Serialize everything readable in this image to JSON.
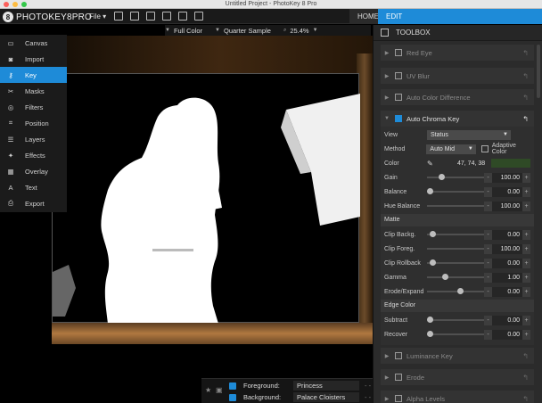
{
  "window": {
    "title": "Untitled Project - PhotoKey 8 Pro"
  },
  "app": {
    "logo_text": "PHOTOKEY8PRO",
    "file_menu": "File",
    "tabs": {
      "home": "HOME",
      "edit": "EDIT"
    }
  },
  "viewbar": {
    "display": "Full Color",
    "quality": "Quarter Sample",
    "zoom": "25.4%"
  },
  "tools": [
    {
      "label": "Canvas",
      "icon": "canvas-icon",
      "active": false
    },
    {
      "label": "Import",
      "icon": "camera-icon",
      "active": false
    },
    {
      "label": "Key",
      "icon": "key-icon",
      "active": true
    },
    {
      "label": "Masks",
      "icon": "scissors-icon",
      "active": false
    },
    {
      "label": "Filters",
      "icon": "filters-icon",
      "active": false
    },
    {
      "label": "Position",
      "icon": "crop-icon",
      "active": false
    },
    {
      "label": "Layers",
      "icon": "layers-icon",
      "active": false
    },
    {
      "label": "Effects",
      "icon": "wand-icon",
      "active": false
    },
    {
      "label": "Overlay",
      "icon": "grid-icon",
      "active": false
    },
    {
      "label": "Text",
      "icon": "text-icon",
      "active": false
    },
    {
      "label": "Export",
      "icon": "export-icon",
      "active": false
    }
  ],
  "layers": {
    "foreground_label": "Foreground:",
    "foreground_value": "Princess",
    "background_label": "Background:",
    "background_value": "Palace Cloisters"
  },
  "toolbox": {
    "title": "TOOLBOX",
    "sections_top": [
      "Red Eye",
      "UV Blur",
      "Auto Color Difference"
    ],
    "chroma": {
      "title": "Auto Chroma Key",
      "view_label": "View",
      "view_value": "Status",
      "method_label": "Method",
      "method_value": "Auto Mid",
      "adaptive_label": "Adaptive Color",
      "color_label": "Color",
      "color_rgb": "47, 74, 38",
      "color_hex": "#2f4a26",
      "sliders": [
        {
          "label": "Gain",
          "value": "100.00",
          "pos": 0.2
        },
        {
          "label": "Balance",
          "value": "0.00",
          "pos": 0.0
        },
        {
          "label": "Hue Balance",
          "value": "100.00",
          "pos": 0.95
        }
      ],
      "matte_title": "Matte",
      "matte": [
        {
          "label": "Clip Backg.",
          "value": "0.00",
          "pos": 0.05
        },
        {
          "label": "Clip Foreg.",
          "value": "100.00",
          "pos": 0.95
        },
        {
          "label": "Clip Rollback",
          "value": "0.00",
          "pos": 0.05
        },
        {
          "label": "Gamma",
          "value": "1.00",
          "pos": 0.25
        },
        {
          "label": "Erode/Expand",
          "value": "0.00",
          "pos": 0.5
        }
      ],
      "edge_title": "Edge Color",
      "edge": [
        {
          "label": "Subtract",
          "value": "0.00",
          "pos": 0.0
        },
        {
          "label": "Recover",
          "value": "0.00",
          "pos": 0.0
        }
      ]
    },
    "sections_bottom": [
      "Luminance Key",
      "Erode",
      "Alpha Levels"
    ]
  }
}
